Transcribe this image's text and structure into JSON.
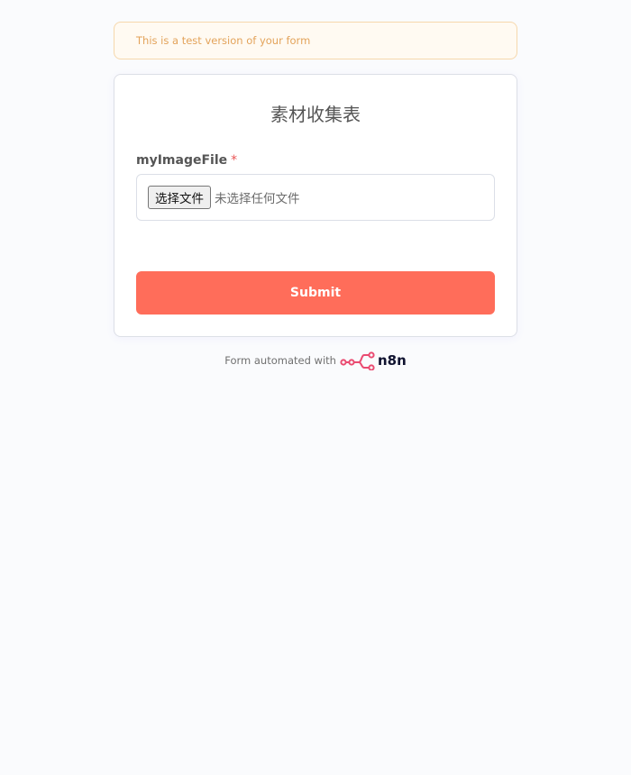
{
  "banner": {
    "text": "This is a test version of your form"
  },
  "form": {
    "title": "素材收集表",
    "fields": [
      {
        "label": "myImageFile",
        "required_mark": "*",
        "file_button_label": "选择文件",
        "file_status": "未选择任何文件"
      }
    ],
    "submit_label": "Submit"
  },
  "footer": {
    "text": "Form automated with",
    "brand": "n8n",
    "brand_icon": "n8n-logo-icon"
  },
  "colors": {
    "accent": "#ff6d5a",
    "background": "#fafbfd",
    "banner_text": "#e3a35a",
    "banner_border": "#f6d8ac",
    "required": "#ea5555",
    "logo": "#ea4b71"
  }
}
